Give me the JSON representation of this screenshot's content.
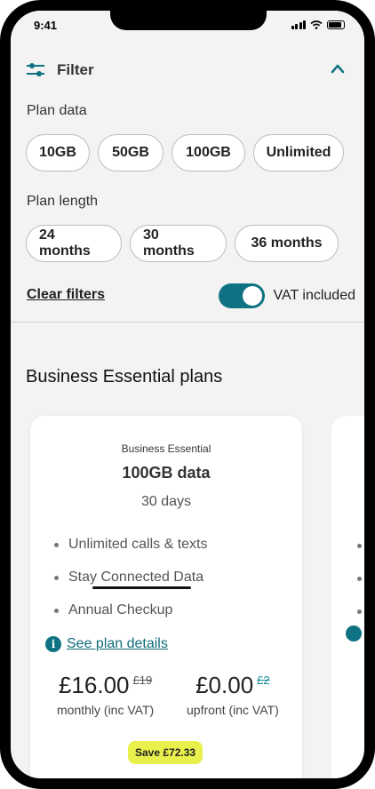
{
  "status_bar": {
    "time": "9:41"
  },
  "filter": {
    "title": "Filter",
    "plan_data_label": "Plan data",
    "plan_data_options": [
      "10GB",
      "50GB",
      "100GB",
      "Unlimited"
    ],
    "plan_length_label": "Plan length",
    "plan_length_options": [
      "24 months",
      "30 months",
      "36 months"
    ],
    "clear_label": "Clear filters",
    "vat_label": "VAT included",
    "vat_enabled": true
  },
  "plans": {
    "heading": "Business Essential plans",
    "card": {
      "eyebrow": "Business Essential",
      "title": "100GB data",
      "duration": "30 days",
      "features": [
        "Unlimited calls & texts",
        "Stay Connected Data",
        "Annual Checkup"
      ],
      "details_link": "See plan details",
      "monthly_price": "£16.00",
      "monthly_old": "£19",
      "monthly_label": "monthly (inc VAT)",
      "upfront_price": "£0.00",
      "upfront_old": "£2",
      "upfront_label": "upfront (inc VAT)",
      "save_label": "Save £72.33"
    }
  },
  "colors": {
    "accent": "#0f7282",
    "save_badge": "#e8f04b",
    "background": "#f3f3f3"
  }
}
